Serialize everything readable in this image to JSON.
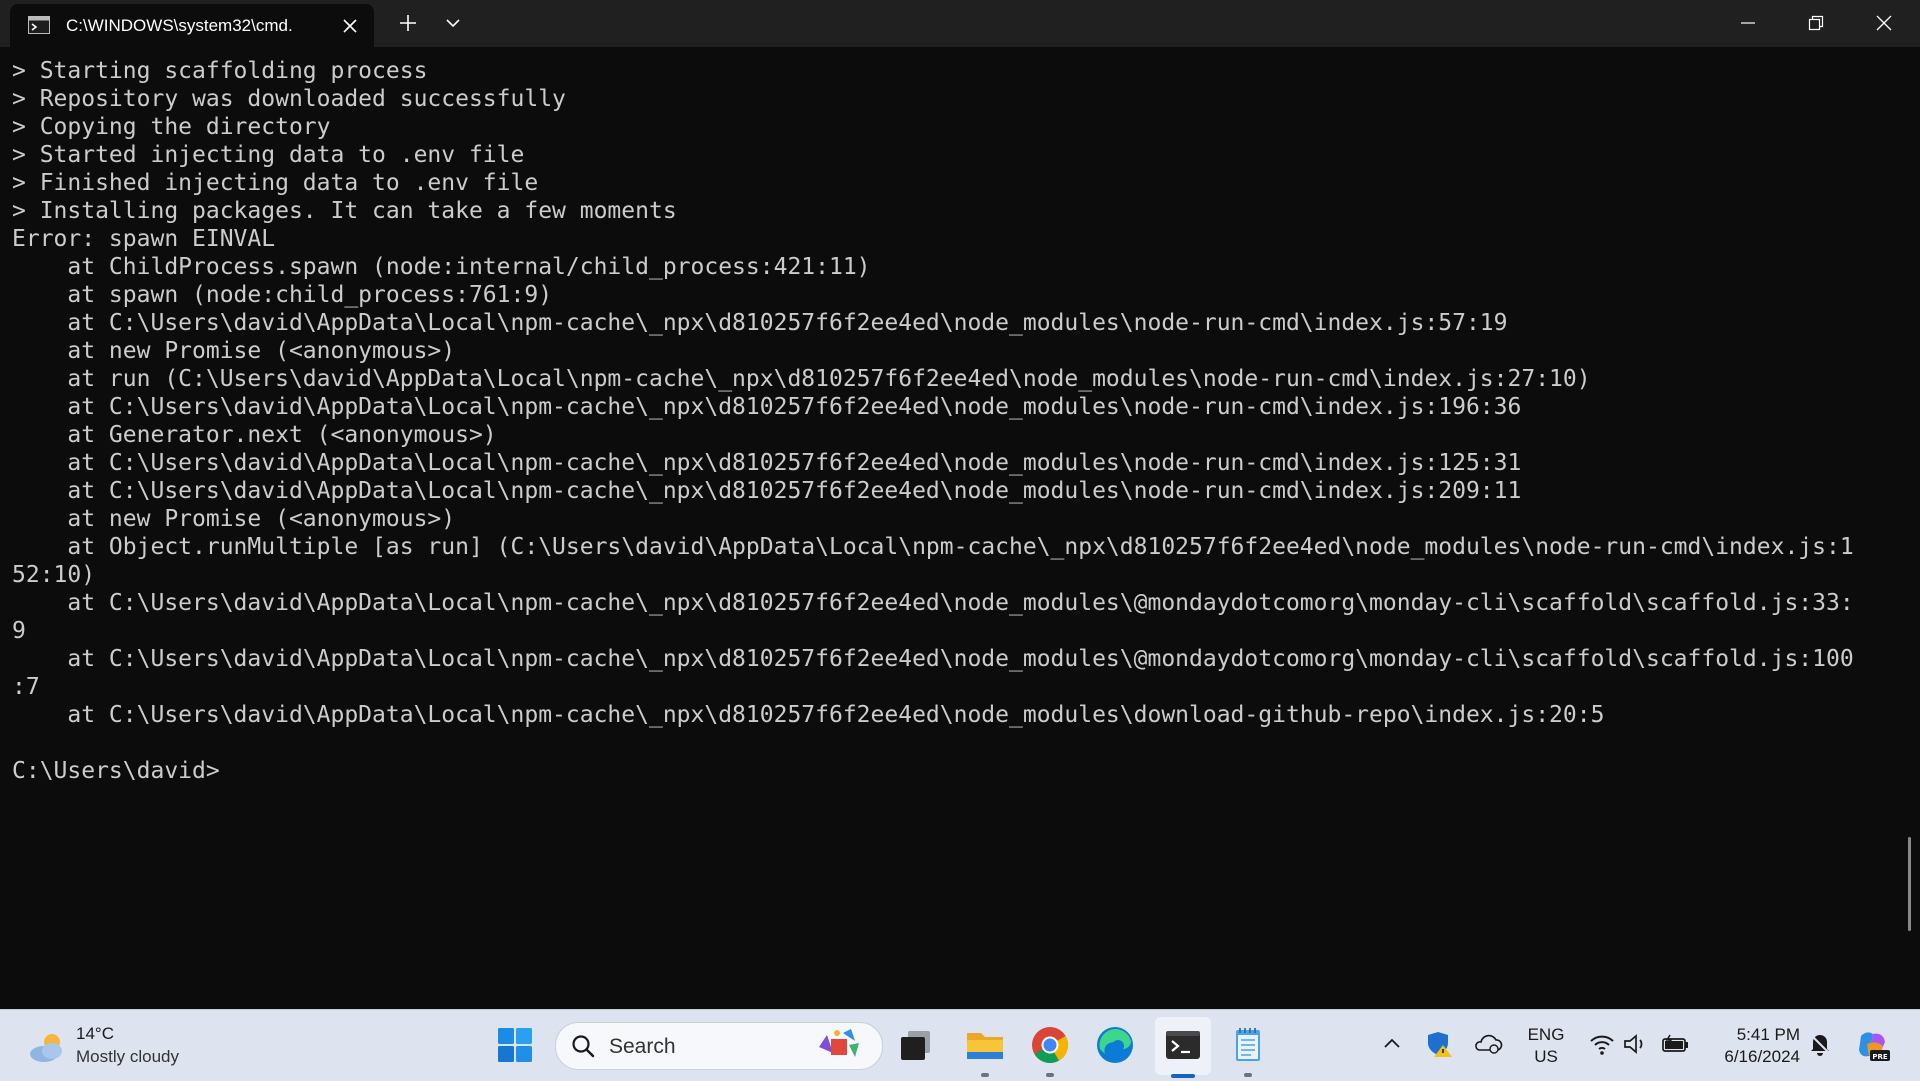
{
  "window": {
    "tab_title": "C:\\WINDOWS\\system32\\cmd.",
    "tab_icon": "cmd-icon",
    "new_tab_icon": "plus-icon",
    "dropdown_icon": "chevron-down-icon",
    "controls": [
      "minimize-icon",
      "restore-icon",
      "close-icon"
    ]
  },
  "terminal": {
    "background": "#0c0c0c",
    "foreground": "#cccccc",
    "lines": [
      "> Starting scaffolding process",
      "> Repository was downloaded successfully",
      "> Copying the directory",
      "> Started injecting data to .env file",
      "> Finished injecting data to .env file",
      "> Installing packages. It can take a few moments",
      "Error: spawn EINVAL",
      "    at ChildProcess.spawn (node:internal/child_process:421:11)",
      "    at spawn (node:child_process:761:9)",
      "    at C:\\Users\\david\\AppData\\Local\\npm-cache\\_npx\\d810257f6f2ee4ed\\node_modules\\node-run-cmd\\index.js:57:19",
      "    at new Promise (<anonymous>)",
      "    at run (C:\\Users\\david\\AppData\\Local\\npm-cache\\_npx\\d810257f6f2ee4ed\\node_modules\\node-run-cmd\\index.js:27:10)",
      "    at C:\\Users\\david\\AppData\\Local\\npm-cache\\_npx\\d810257f6f2ee4ed\\node_modules\\node-run-cmd\\index.js:196:36",
      "    at Generator.next (<anonymous>)",
      "    at C:\\Users\\david\\AppData\\Local\\npm-cache\\_npx\\d810257f6f2ee4ed\\node_modules\\node-run-cmd\\index.js:125:31",
      "    at C:\\Users\\david\\AppData\\Local\\npm-cache\\_npx\\d810257f6f2ee4ed\\node_modules\\node-run-cmd\\index.js:209:11",
      "    at new Promise (<anonymous>)",
      "    at Object.runMultiple [as run] (C:\\Users\\david\\AppData\\Local\\npm-cache\\_npx\\d810257f6f2ee4ed\\node_modules\\node-run-cmd\\index.js:1",
      "52:10)",
      "    at C:\\Users\\david\\AppData\\Local\\npm-cache\\_npx\\d810257f6f2ee4ed\\node_modules\\@mondaydotcomorg\\monday-cli\\scaffold\\scaffold.js:33:",
      "9",
      "    at C:\\Users\\david\\AppData\\Local\\npm-cache\\_npx\\d810257f6f2ee4ed\\node_modules\\@mondaydotcomorg\\monday-cli\\scaffold\\scaffold.js:100",
      ":7",
      "    at C:\\Users\\david\\AppData\\Local\\npm-cache\\_npx\\d810257f6f2ee4ed\\node_modules\\download-github-repo\\index.js:20:5",
      "",
      "C:\\Users\\david>"
    ]
  },
  "taskbar": {
    "weather": {
      "temp": "14°C",
      "condition": "Mostly cloudy",
      "icon": "partly-cloudy-icon"
    },
    "search": {
      "placeholder": "Search"
    },
    "apps": [
      "windows-start-icon",
      "task-view-icon",
      "file-explorer-icon",
      "chrome-icon",
      "edge-icon",
      "terminal-icon",
      "notepad-icon"
    ],
    "active_app": "terminal-icon",
    "tray": {
      "icons": [
        "chevron-up-icon",
        "defender-shield-icon",
        "onedrive-icon",
        "wifi-icon",
        "volume-icon",
        "battery-icon",
        "notification-icon",
        "copilot-icon"
      ],
      "language": "ENG",
      "region": "US",
      "time": "5:41 PM",
      "date": "6/16/2024"
    }
  }
}
